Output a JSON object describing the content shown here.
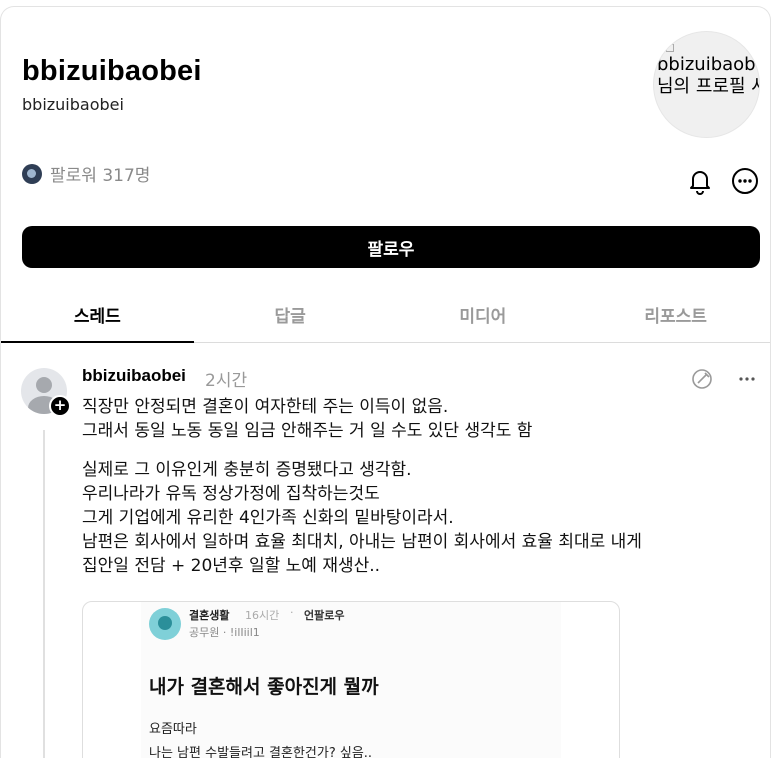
{
  "profile": {
    "display_name": "bbizuibaobei",
    "username": "bbizuibaobei",
    "picture_alt": "bbizuibaobei님의 프로필 사진",
    "followers_text": "팔로워 317명"
  },
  "actions": {
    "follow_label": "팔로우"
  },
  "tabs": [
    {
      "label": "스레드",
      "active": true
    },
    {
      "label": "답글",
      "active": false
    },
    {
      "label": "미디어",
      "active": false
    },
    {
      "label": "리포스트",
      "active": false
    }
  ],
  "post": {
    "author": "bbizuibaobei",
    "time": "2시간",
    "paragraph1": [
      "직장만 안정되면 결혼이 여자한테 주는 이득이 없음.",
      "그래서 동일 노동 동일 임금 안해주는 거 일 수도 있단 생각도 함"
    ],
    "paragraph2": [
      "실제로 그 이유인게 충분히 증명됐다고 생각함.",
      "우리나라가 유독 정상가정에 집착하는것도",
      "그게 기업에게 유리한 4인가족 신화의 밑바탕이라서.",
      "남편은 회사에서 일하며 효율 최대치, 아내는 남편이 회사에서 효율 최대로 내게",
      "집안일 전담 + 20년후 일할 노예 재생산.."
    ],
    "embed": {
      "community": "결혼생활",
      "age": "16시간",
      "separator": "·",
      "follow": "언팔로우",
      "subtitle": "공무원 · !ilIiil1",
      "title": "내가 결혼해서 좋아진게 뭘까",
      "line1": "요즘따라",
      "line2": "나는 남편 수발들려고 결혼한건가? 싶음.."
    }
  },
  "colors": {
    "accent": "#000000",
    "muted_text": "#999999",
    "divider": "#dcdcdc"
  },
  "icons": [
    "bell-icon",
    "more-options-icon",
    "plus-icon",
    "edit-icon",
    "ellipsis-icon"
  ]
}
